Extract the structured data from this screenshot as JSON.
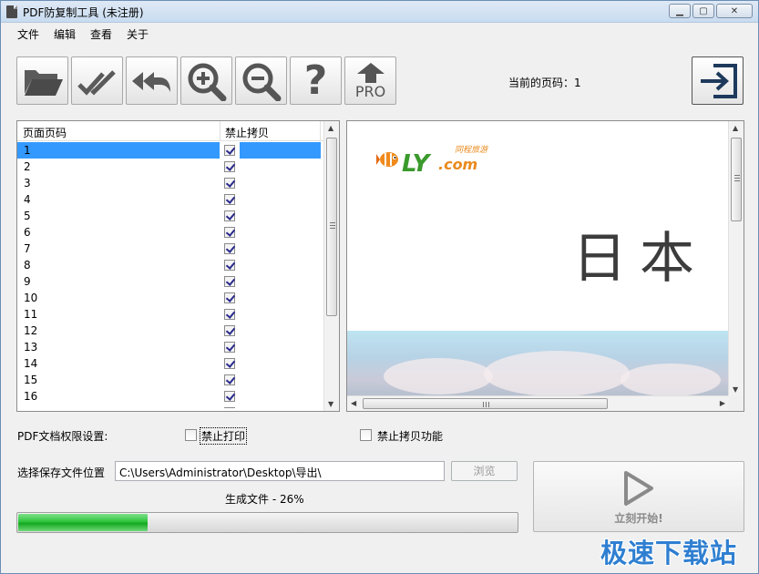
{
  "window": {
    "title": "PDF防复制工具 (未注册)"
  },
  "menu": [
    "文件",
    "编辑",
    "查看",
    "关于"
  ],
  "toolbar": {
    "buttons": [
      "open-folder-icon",
      "check-all-icon",
      "undo-all-icon",
      "zoom-in-icon",
      "zoom-out-icon",
      "help-icon",
      "pro-upgrade-icon"
    ],
    "pro_label": "PRO",
    "help_glyph": "?",
    "page_label": "当前的页码：1",
    "exit_icon": "exit-icon"
  },
  "list": {
    "col_page": "页面页码",
    "col_protect": "禁止拷贝",
    "rows": [
      {
        "num": "1",
        "checked": true,
        "selected": true
      },
      {
        "num": "2",
        "checked": true
      },
      {
        "num": "3",
        "checked": true
      },
      {
        "num": "4",
        "checked": true
      },
      {
        "num": "5",
        "checked": true
      },
      {
        "num": "6",
        "checked": true
      },
      {
        "num": "7",
        "checked": true
      },
      {
        "num": "8",
        "checked": true
      },
      {
        "num": "9",
        "checked": true
      },
      {
        "num": "10",
        "checked": true
      },
      {
        "num": "11",
        "checked": true
      },
      {
        "num": "12",
        "checked": true
      },
      {
        "num": "13",
        "checked": true
      },
      {
        "num": "14",
        "checked": true
      },
      {
        "num": "15",
        "checked": true
      },
      {
        "num": "16",
        "checked": true
      }
    ]
  },
  "preview": {
    "logo_text": "LY",
    "logo_dotcom": ".com",
    "logo_sub": "同程旅游",
    "title": "日本"
  },
  "permissions": {
    "label": "PDF文档权限设置:",
    "no_print": "禁止打印",
    "no_print_checked": false,
    "no_copy": "禁止拷贝功能",
    "no_copy_checked": false
  },
  "save": {
    "label": "选择保存文件位置",
    "path": "C:\\Users\\Administrator\\Desktop\\导出\\",
    "browse": "浏览"
  },
  "progress": {
    "text": "生成文件 - 26%",
    "value": 0.26
  },
  "start": {
    "label": "立刻开始!",
    "icon": "play-icon"
  },
  "watermark": "极速下载站",
  "colors": {
    "selection": "#3399ff",
    "progress": "#2fc43c",
    "watermark": "#2f7fd1"
  }
}
